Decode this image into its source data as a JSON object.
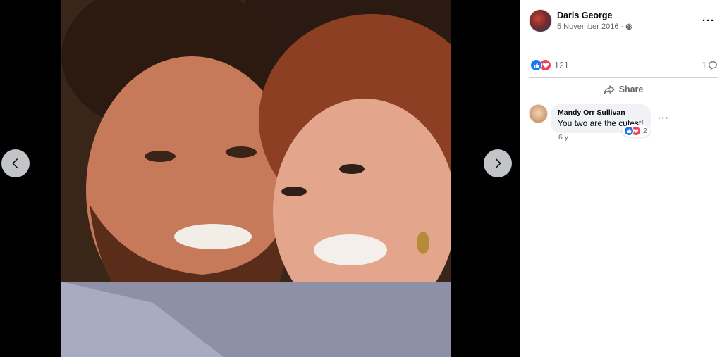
{
  "post": {
    "author": "Daris George",
    "date": "5 November 2016",
    "separator": "·",
    "privacy_icon": "globe-icon",
    "more_label": "···"
  },
  "reactions": {
    "count": "121",
    "types": [
      "like-icon",
      "love-icon"
    ],
    "comments_count": "1"
  },
  "actions": {
    "share_label": "Share"
  },
  "comments": [
    {
      "author": "Mandy Orr Sullivan",
      "text": "You two are the cutest!",
      "reaction_count": "2",
      "time": "6 y",
      "more_label": "···"
    }
  ],
  "colors": {
    "like": "#1877f2",
    "love": "#f33e58",
    "secondary_text": "#65676b",
    "bubble": "#f0f2f5"
  }
}
